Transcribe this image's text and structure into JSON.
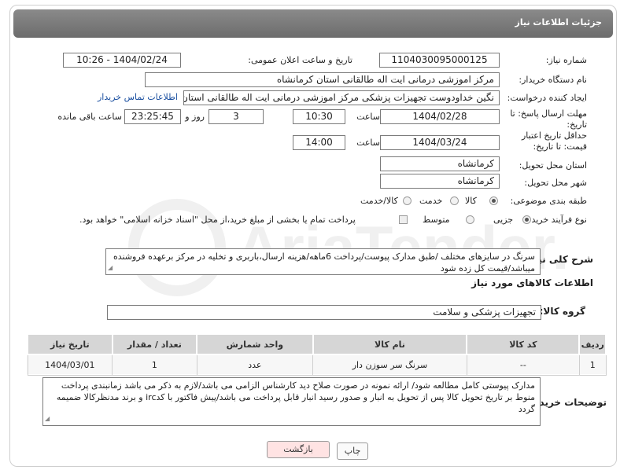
{
  "header": {
    "title": "جزئیات اطلاعات نیاز"
  },
  "form": {
    "need_number_label": "شماره نیاز:",
    "need_number": "1104030095000125",
    "announce_label": "تاریخ و ساعت اعلان عمومی:",
    "announce_value": "1404/02/24 - 10:26",
    "buyer_label": "نام دستگاه خریدار:",
    "buyer_value": "مرکز اموزشی درمانی ایت اله طالقانی استان کرمانشاه",
    "creator_label": "ایجاد کننده درخواست:",
    "creator_value": "نگین خداودوست تجهیزات پزشکی مرکز اموزشی درمانی ایت اله طالقانی استان",
    "contact_link": "اطلاعات تماس خریدار",
    "deadline_label": "مهلت ارسال پاسخ: تا تاریخ:",
    "deadline_date": "1404/02/28",
    "time_label": "ساعت",
    "deadline_time": "10:30",
    "days_value": "3",
    "days_label": "روز و",
    "remaining_time": "23:25:45",
    "remaining_label": "ساعت باقی مانده",
    "validity_label": "حداقل تاریخ اعتبار قیمت: تا تاریخ:",
    "validity_date": "1404/03/24",
    "validity_time_label": "ساعت",
    "validity_time": "14:00",
    "province_label": "استان محل تحویل:",
    "province_value": "کرمانشاه",
    "city_label": "شهر محل تحویل:",
    "city_value": "کرمانشاه",
    "category_label": "طبقه بندی موضوعی:",
    "category_options": [
      "کالا",
      "خدمت",
      "کالا/خدمت"
    ],
    "category_selected": "کالا",
    "process_label": "نوع فرآیند خرید :",
    "process_options": [
      "جزیی",
      "متوسط"
    ],
    "process_selected": "جزیی",
    "payment_note": "پرداخت تمام یا بخشی از مبلغ خرید،از محل \"اسناد خزانه اسلامی\" خواهد بود."
  },
  "summary": {
    "label": "شرح کلی نیاز:",
    "text": "سرنگ در سایزهای مختلف /طبق مدارک پیوست/پرداخت 6ماهه/هزینه ارسال،باربری و تخلیه در مرکز برعهده فروشنده میباشد/قیمت کل زده شود"
  },
  "goods": {
    "section_title": "اطلاعات کالاهای مورد نیاز",
    "group_label": "گروه کالا:",
    "group_value": "تجهیزات پزشکی و سلامت",
    "columns": [
      "ردیف",
      "کد کالا",
      "نام کالا",
      "واحد شمارش",
      "تعداد / مقدار",
      "تاریخ نیاز"
    ],
    "rows": [
      [
        "1",
        "--",
        "سرنگ سر سوزن دار",
        "عدد",
        "1",
        "1404/03/01"
      ]
    ]
  },
  "buyer_notes": {
    "label": "توضیحات خریدار:",
    "text": "مدارک پیوستی کامل مطالعه شود/ ارائه نمونه در صورت صلاح دید کارشناس الزامی می باشد/لازم به ذکر می باشد زمانبندی پرداخت منوط بر تاریخ تحویل کالا پس از تحویل به انبار و صدور رسید انبار قابل پرداخت می باشد/پیش فاکتور با کدirc و برند مدنظرکالا ضمیمه گردد"
  },
  "buttons": {
    "back": "بازگشت",
    "print": "چاپ"
  }
}
